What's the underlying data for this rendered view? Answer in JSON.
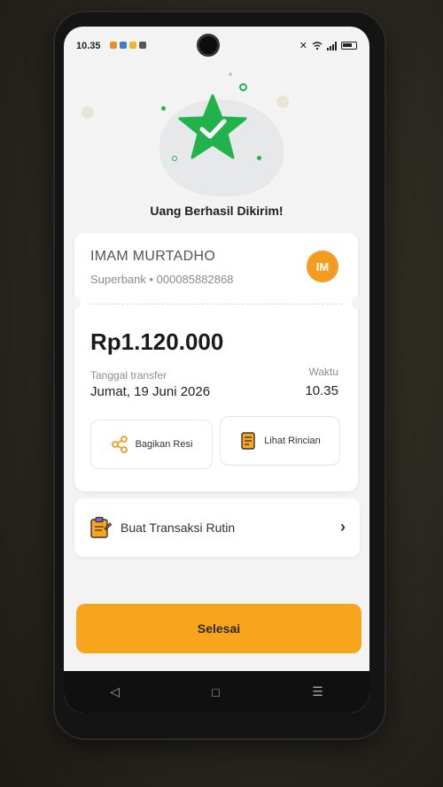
{
  "status_bar": {
    "time": "10.35"
  },
  "title": "Uang Berhasil Dikirim!",
  "recipient": {
    "name": "IMAM MURTADHO",
    "bank_account": "Superbank • 000085882868",
    "initials": "IM"
  },
  "amount": "Rp1.120.000",
  "date": {
    "label": "Tanggal transfer",
    "value": "Jumat, 19 Juni 2026"
  },
  "time": {
    "label": "Waktu",
    "value": "10.35"
  },
  "actions": {
    "share_label": "Bagikan Resi",
    "details_label": "Lihat Rincian"
  },
  "routine": {
    "label": "Buat Transaksi Rutin"
  },
  "done_label": "Selesai",
  "colors": {
    "accent": "#f8a51e",
    "success": "#22b24c",
    "avatar": "#f39c1f"
  },
  "icons": {
    "success": "star-check-icon",
    "share": "share-icon",
    "details": "receipt-icon",
    "routine": "clipboard-icon",
    "chevron": "chevron-right-icon"
  }
}
